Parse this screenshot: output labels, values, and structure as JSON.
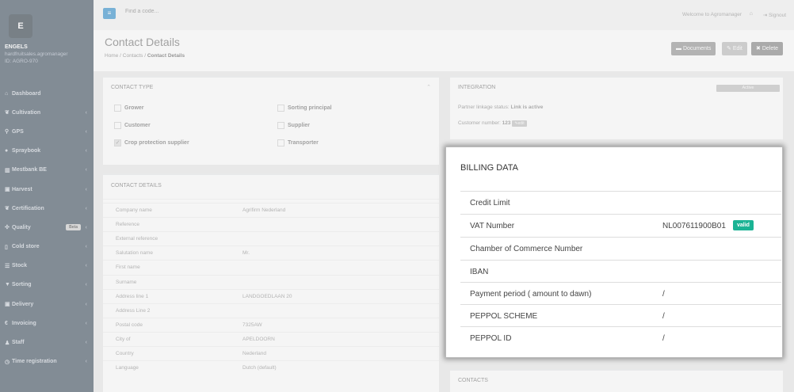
{
  "sidebar": {
    "logo": "E",
    "user_name": "ENGELS",
    "user_email": "hardfruitsales.agromanager",
    "user_id": "ID: AGRO-970",
    "items": [
      {
        "label": "Dashboard",
        "icon": "home-icon"
      },
      {
        "label": "Cultivation",
        "icon": "leaf-icon"
      },
      {
        "label": "GPS",
        "icon": "map-marker-icon"
      },
      {
        "label": "Spraybook",
        "icon": "drop-icon"
      },
      {
        "label": "Mestbank BE",
        "icon": "bank-icon"
      },
      {
        "label": "Harvest",
        "icon": "truck-icon"
      },
      {
        "label": "Certification",
        "icon": "leaf-icon"
      },
      {
        "label": "Quality",
        "icon": "quality-icon",
        "badge": "Beta"
      },
      {
        "label": "Cold store",
        "icon": "cold-store-icon"
      },
      {
        "label": "Stock",
        "icon": "list-icon"
      },
      {
        "label": "Sorting",
        "icon": "filter-icon"
      },
      {
        "label": "Delivery",
        "icon": "truck-icon"
      },
      {
        "label": "Invoicing",
        "icon": "euro-icon"
      },
      {
        "label": "Staff",
        "icon": "user-icon"
      },
      {
        "label": "Time registration",
        "icon": "clock-icon"
      }
    ]
  },
  "topbar": {
    "search_placeholder": "Find a code...",
    "welcome": "Welcome to Agromanager",
    "signout": "Signout"
  },
  "heading": {
    "title": "Contact Details",
    "breadcrumb": [
      "Home",
      "Contacts",
      "Contact Details"
    ],
    "buttons": {
      "documents": "Documents",
      "edit": "Edit",
      "delete": "Delete"
    }
  },
  "contact_type": {
    "title": "CONTACT TYPE",
    "options": [
      "Grower",
      "Sorting principal",
      "Customer",
      "Supplier",
      "Crop protection supplier",
      "Transporter"
    ]
  },
  "integration": {
    "title": "INTEGRATION",
    "status_badge": "Active",
    "linkage_label": "Partner linkage status:",
    "linkage_value": "Link is active",
    "customer_label": "Customer number:",
    "customer_value": "123",
    "edit_label": "edit"
  },
  "contact_details": {
    "title": "CONTACT DETAILS",
    "rows": [
      {
        "label": "Company name",
        "value": "Agrifirm Nederland"
      },
      {
        "label": "Reference",
        "value": ""
      },
      {
        "label": "External reference",
        "value": ""
      },
      {
        "label": "Salutation name",
        "value": "Mr."
      },
      {
        "label": "First name",
        "value": ""
      },
      {
        "label": "Surname",
        "value": ""
      },
      {
        "label": "Address line 1",
        "value": "LANDGOEDLAAN 20"
      },
      {
        "label": "Address Line 2",
        "value": ""
      },
      {
        "label": "Postal code",
        "value": "7325AW"
      },
      {
        "label": "City of",
        "value": "APELDOORN"
      },
      {
        "label": "Country",
        "value": "Nederland"
      },
      {
        "label": "Language",
        "value": "Dutch (default)"
      }
    ]
  },
  "billing": {
    "title": "BILLING DATA",
    "rows": [
      {
        "label": "Credit Limit",
        "value": ""
      },
      {
        "label": "VAT Number",
        "value": "NL007611900B01",
        "badge": "valid"
      },
      {
        "label": "Chamber of Commerce Number",
        "value": ""
      },
      {
        "label": "IBAN",
        "value": ""
      },
      {
        "label": "Payment period ( amount to dawn)",
        "value": "/"
      },
      {
        "label": "PEPPOL SCHEME",
        "value": "/"
      },
      {
        "label": "PEPPOL ID",
        "value": "/"
      }
    ]
  },
  "contacts": {
    "title": "CONTACTS"
  },
  "colors": {
    "sidebar": "#2f4050",
    "primary": "#1c84c6",
    "valid": "#1ab394"
  }
}
